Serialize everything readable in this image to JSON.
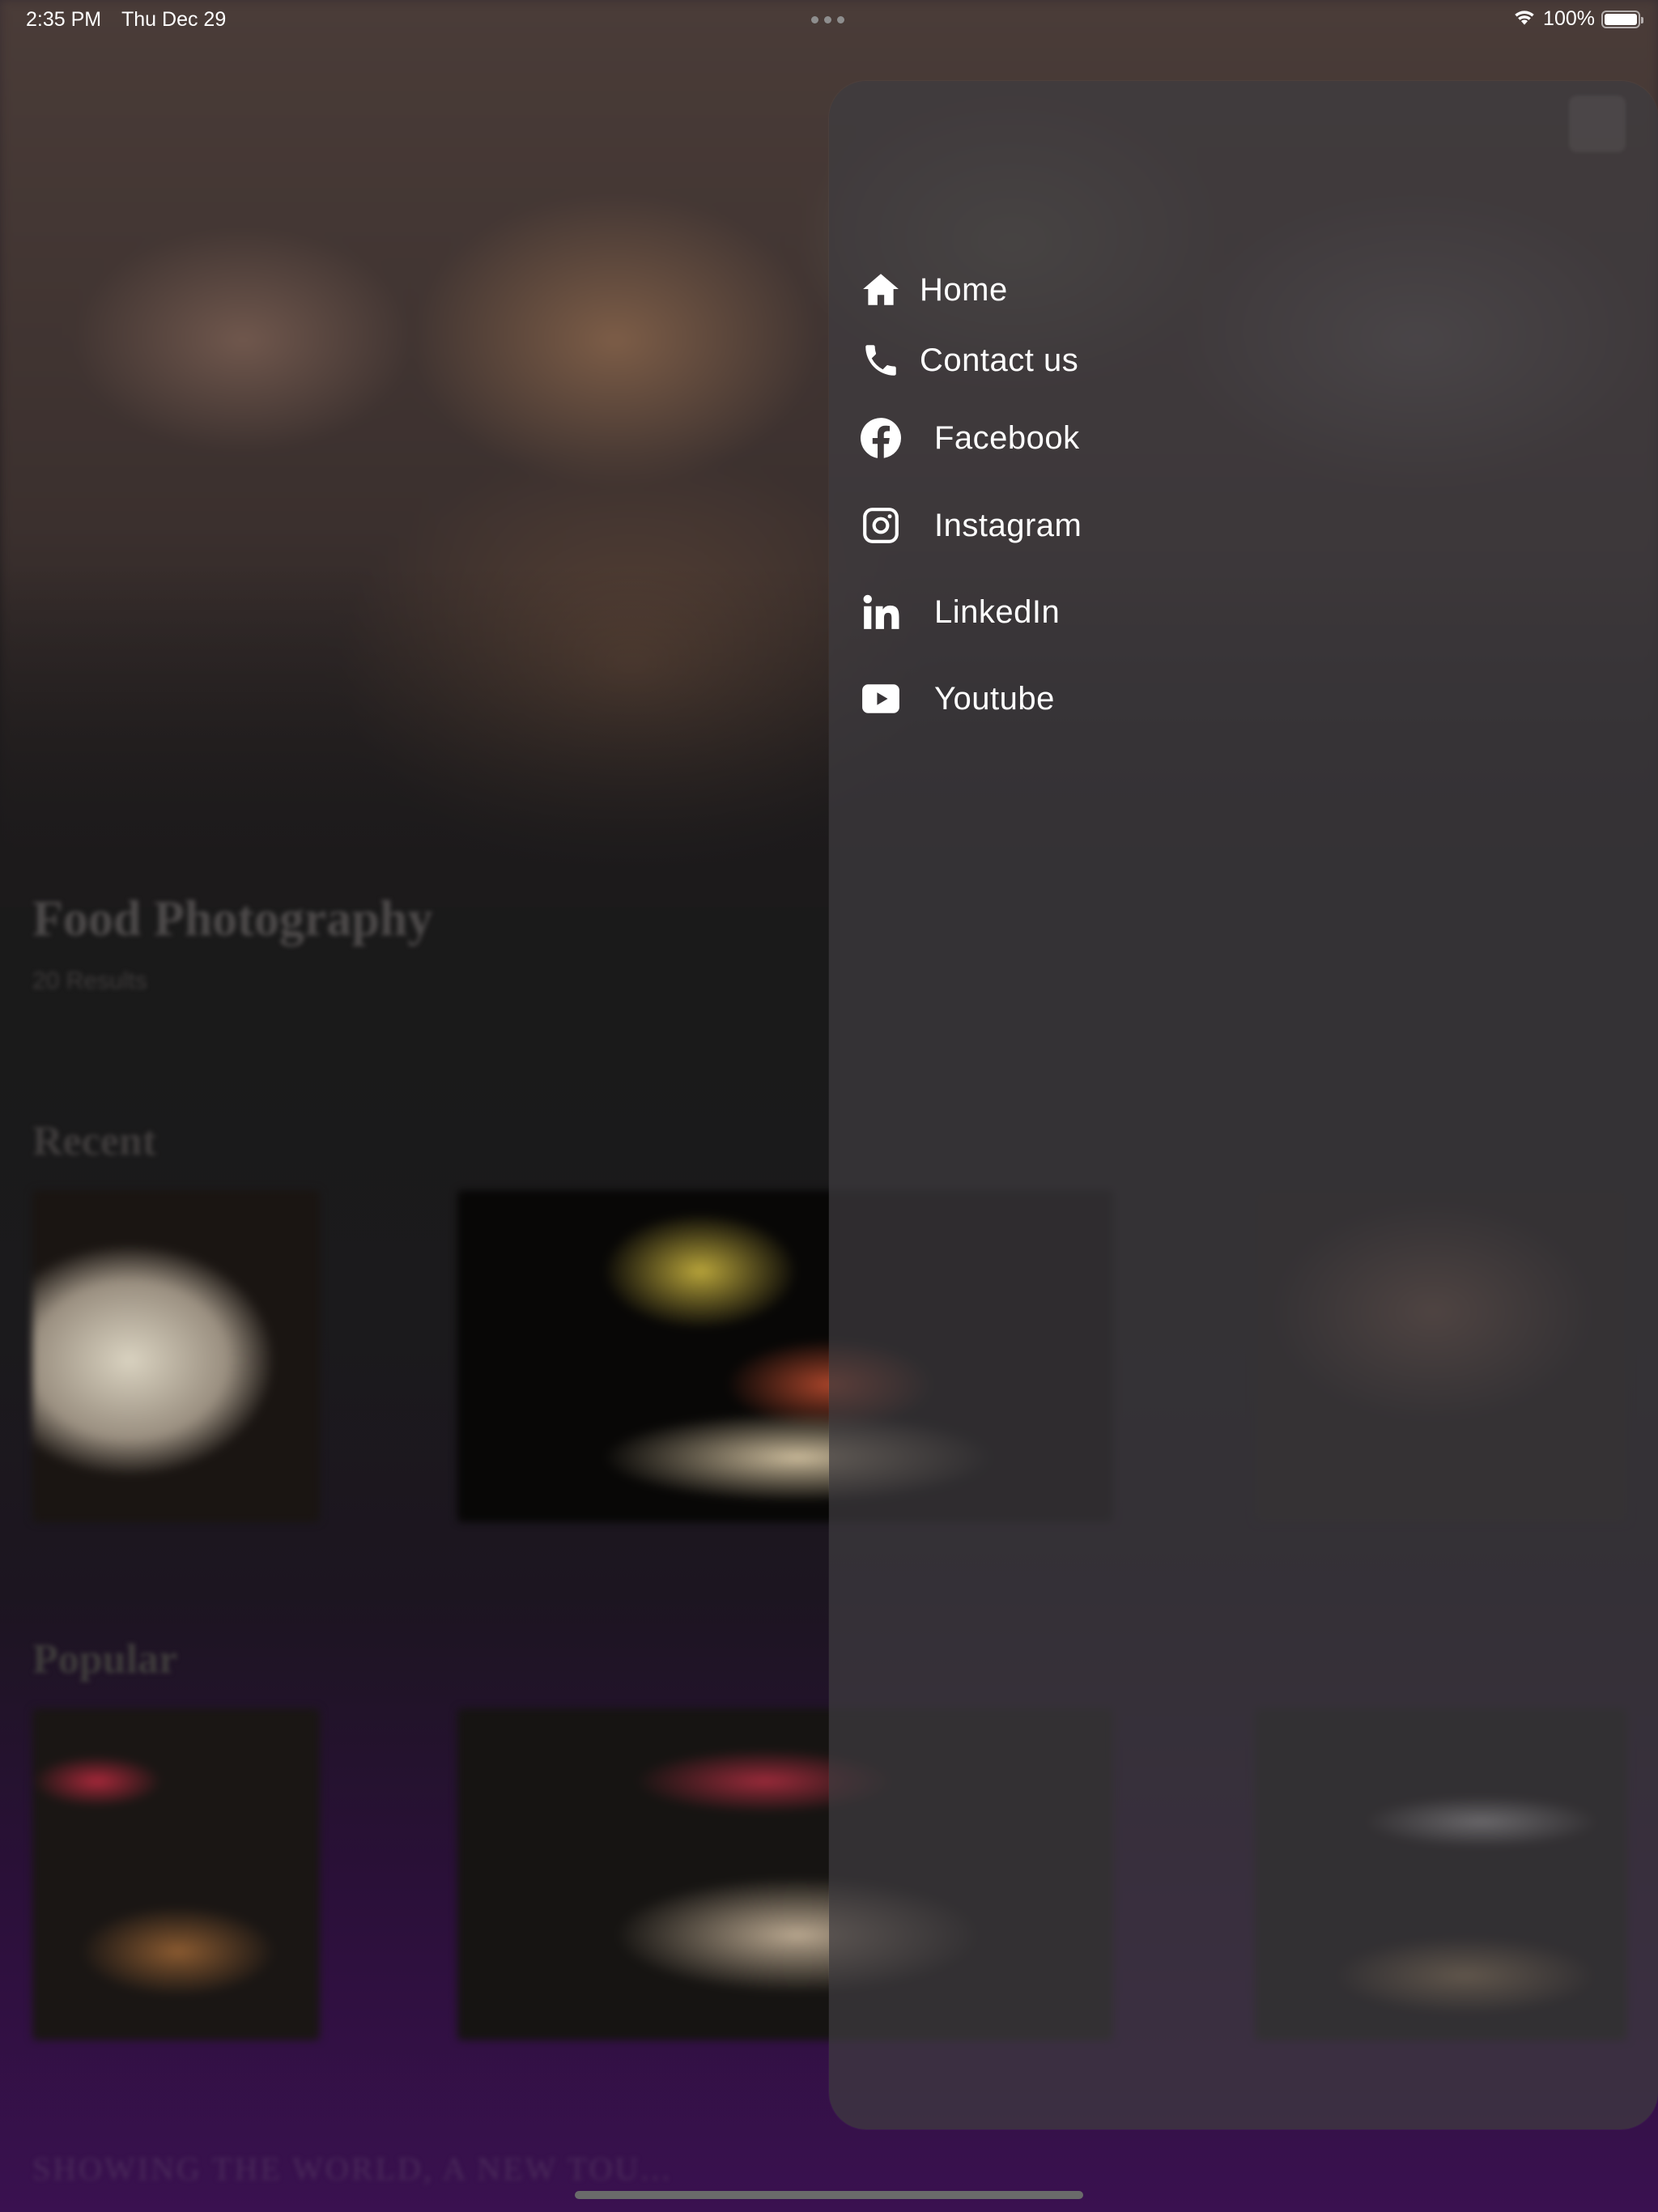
{
  "status_bar": {
    "time": "2:35 PM",
    "date": "Thu Dec 29",
    "battery": "100%",
    "battery_level": 1.0
  },
  "background": {
    "title": "Food Photography",
    "subtitle": "20 Results",
    "sections": [
      {
        "heading": "Recent"
      },
      {
        "heading": "Popular"
      }
    ],
    "tagline": "SHOWING THE WORLD, A NEW TOU..."
  },
  "menu": {
    "items": [
      {
        "label": "Home",
        "icon": "home-icon"
      },
      {
        "label": "Contact us",
        "icon": "phone-icon"
      },
      {
        "label": "Facebook",
        "icon": "facebook-icon"
      },
      {
        "label": "Instagram",
        "icon": "instagram-icon"
      },
      {
        "label": "LinkedIn",
        "icon": "linkedin-icon"
      },
      {
        "label": "Youtube",
        "icon": "youtube-icon"
      }
    ]
  },
  "colors": {
    "drawer": "#3e3c40",
    "text": "#ffffff",
    "bottom_glow": "#3a1150"
  }
}
